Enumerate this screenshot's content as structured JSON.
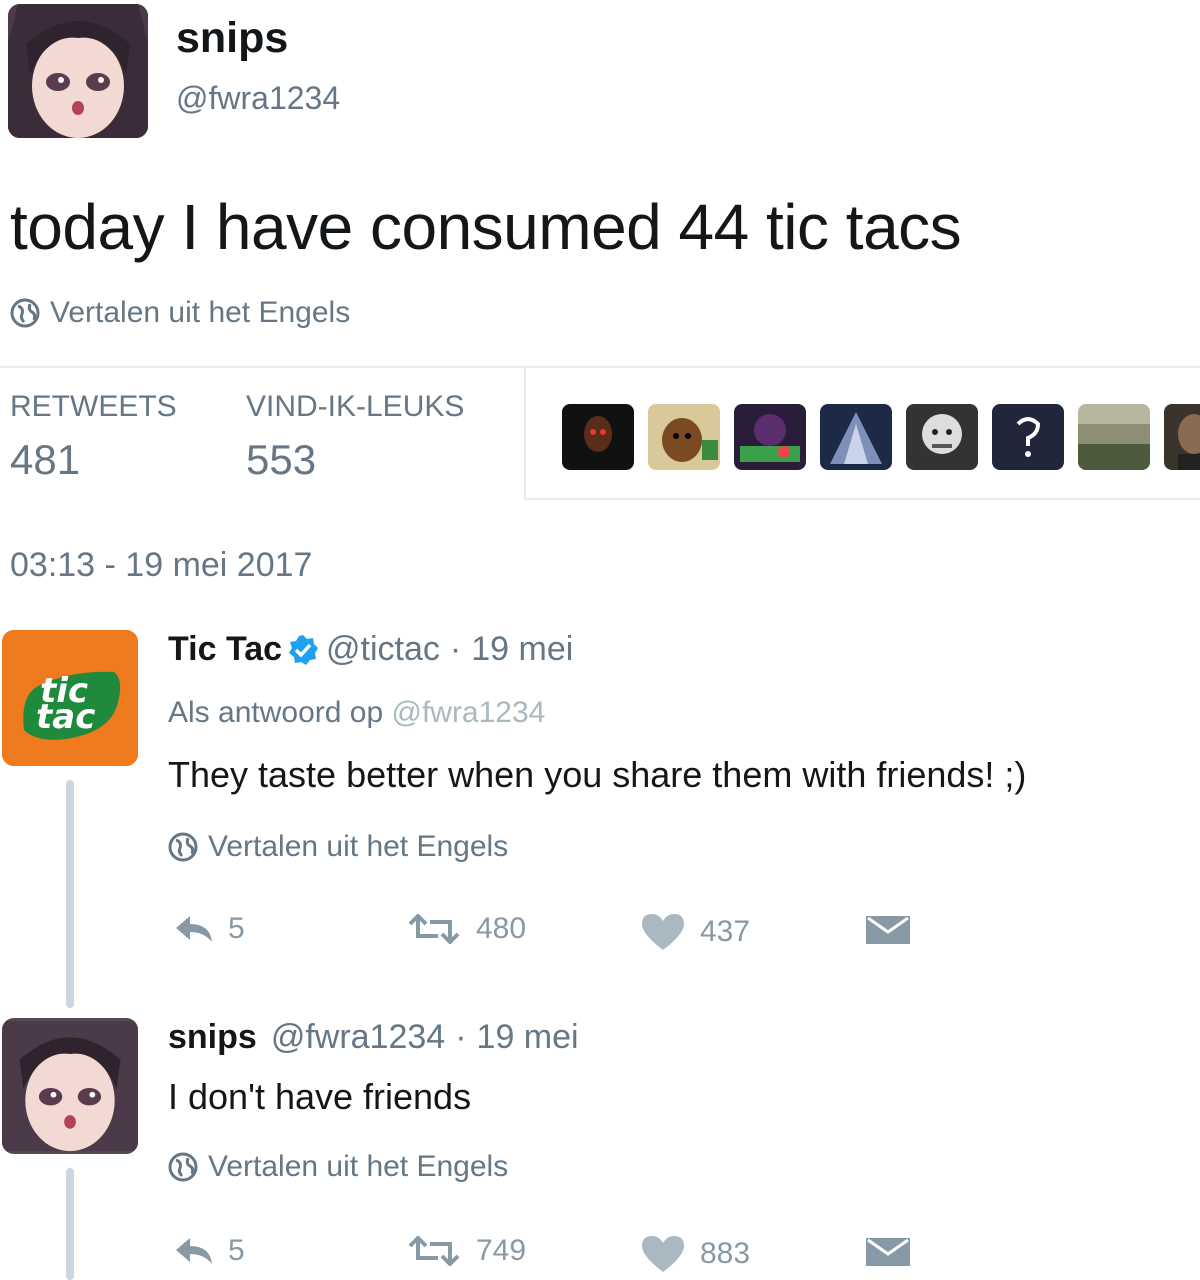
{
  "tweet": {
    "name": "snips",
    "handle": "@fwra1234",
    "text": "today I have consumed 44 tic tacs",
    "translate": "Vertalen uit het Engels",
    "stats": {
      "retweets_label": "RETWEETS",
      "retweets": "481",
      "likes_label": "VIND-IK-LEUKS",
      "likes": "553"
    },
    "timestamp": "03:13 - 19 mei 2017"
  },
  "replies": [
    {
      "name": "Tic Tac",
      "verified": true,
      "handle": "@tictac",
      "sep": "·",
      "date": "19 mei",
      "reply_to_prefix": "Als antwoord op",
      "reply_to_handle": "@fwra1234",
      "text": "They taste better when you share them with friends! ;)",
      "translate": "Vertalen uit het Engels",
      "reply_count": "5",
      "retweet_count": "480",
      "like_count": "437",
      "logo_text_top": "tic",
      "logo_text_bottom": "tac"
    },
    {
      "name": "snips",
      "handle": "@fwra1234",
      "sep": "·",
      "date": "19 mei",
      "text": "I don't have friends",
      "translate": "Vertalen uit het Engels",
      "reply_count": "5",
      "retweet_count": "749",
      "like_count": "883"
    }
  ],
  "colors": {
    "text": "#14171a",
    "muted": "#657786",
    "action": "#8899a6",
    "tic_tac_orange": "#f07b1e",
    "tic_tac_green": "#1f8a3b",
    "verified_blue": "#1da1f2"
  },
  "icons": [
    "globe-icon",
    "verified-icon",
    "reply-icon",
    "retweet-icon",
    "heart-icon",
    "message-icon"
  ]
}
